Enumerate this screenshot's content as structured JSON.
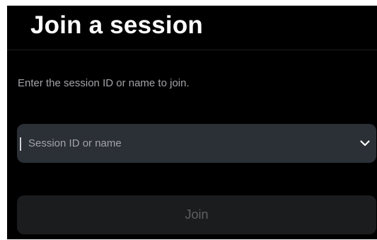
{
  "header": {
    "title": "Join a session"
  },
  "main": {
    "instruction": "Enter the session ID or name to join.",
    "session_field": {
      "value": "",
      "placeholder": "Session ID or name",
      "dropdown_icon": "chevron-down-icon"
    },
    "join_button": {
      "label": "Join",
      "enabled": false
    }
  },
  "colors": {
    "background": "#000000",
    "field_background": "#2b2f36",
    "disabled_button_background": "#1b1c1e",
    "disabled_button_text": "#5f6065",
    "title_text": "#ffffff",
    "secondary_text": "#a4a4a9"
  }
}
